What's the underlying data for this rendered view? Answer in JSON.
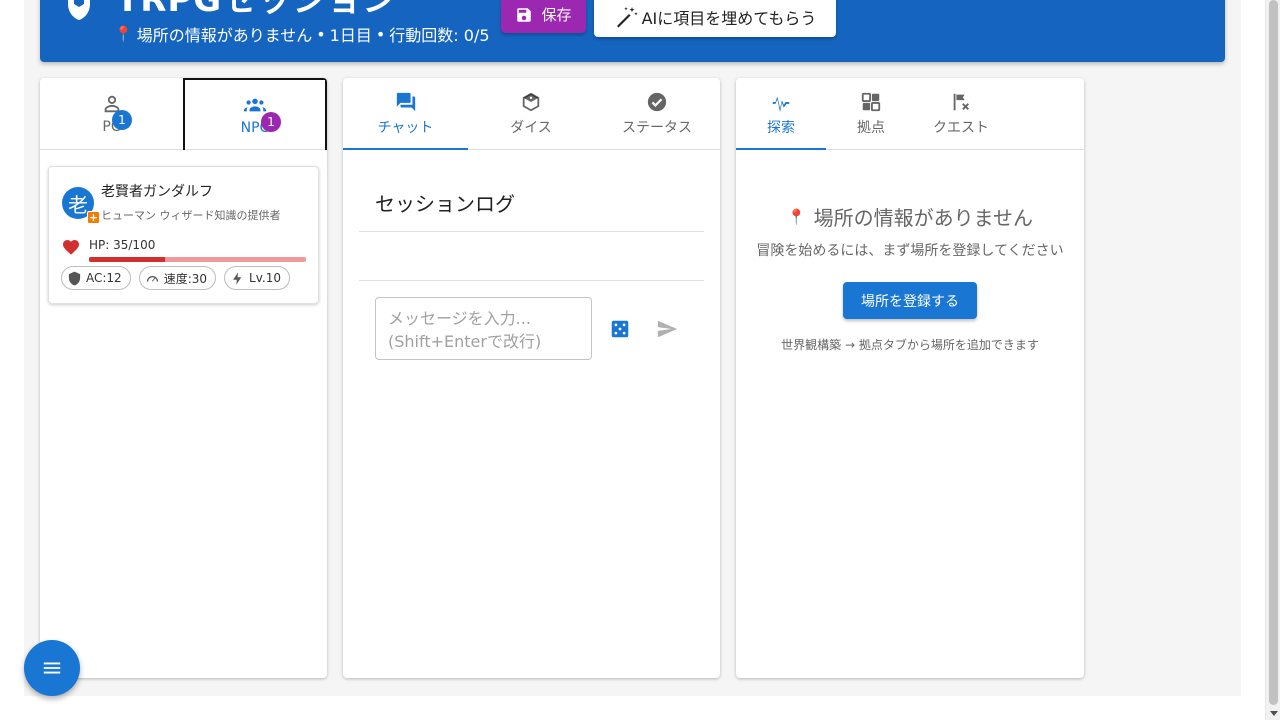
{
  "header": {
    "title": "TRPGセッション",
    "location": "場所の情報がありません",
    "day": "1日目",
    "actions": "行動回数: 0/5",
    "separator": "•",
    "save_label": "保存",
    "ai_fill_label": "AIに項目を埋めてもらう"
  },
  "left_panel": {
    "tabs": [
      {
        "label": "PC",
        "badge": "1",
        "icon": "person-icon"
      },
      {
        "label": "NPC",
        "badge": "1",
        "icon": "group-icon"
      }
    ],
    "npc": {
      "avatar": "老",
      "name": "老賢者ガンダルフ",
      "subtitle": "ヒューマン ウィザード知識の提供者",
      "hp_text": "HP: 35/100",
      "hp_fraction": 0.35,
      "ac": "AC:12",
      "speed": "速度:30",
      "level": "Lv.10"
    }
  },
  "middle_panel": {
    "tabs": [
      {
        "label": "チャット",
        "icon": "forum-icon"
      },
      {
        "label": "ダイス",
        "icon": "dice-icon"
      },
      {
        "label": "ステータス",
        "icon": "check-circle-icon"
      }
    ],
    "log_title": "セッションログ",
    "input_placeholder_line1": "メッセージを入力...",
    "input_placeholder_line2": "(Shift+Enterで改行)"
  },
  "right_panel": {
    "tabs": [
      {
        "label": "探索",
        "icon": "explore-icon"
      },
      {
        "label": "拠点",
        "icon": "grid-icon"
      },
      {
        "label": "クエスト",
        "icon": "quest-icon"
      }
    ],
    "empty_title": "場所の情報がありません",
    "empty_desc": "冒険を始めるには、まず場所を登録してください",
    "register_label": "場所を登録する",
    "hint": "世界観構築 → 拠点タブから場所を追加できます"
  },
  "colors": {
    "primary": "#1976d2",
    "header": "#1565c0",
    "secondary": "#9c27b0",
    "hp": "#d32f2f"
  }
}
